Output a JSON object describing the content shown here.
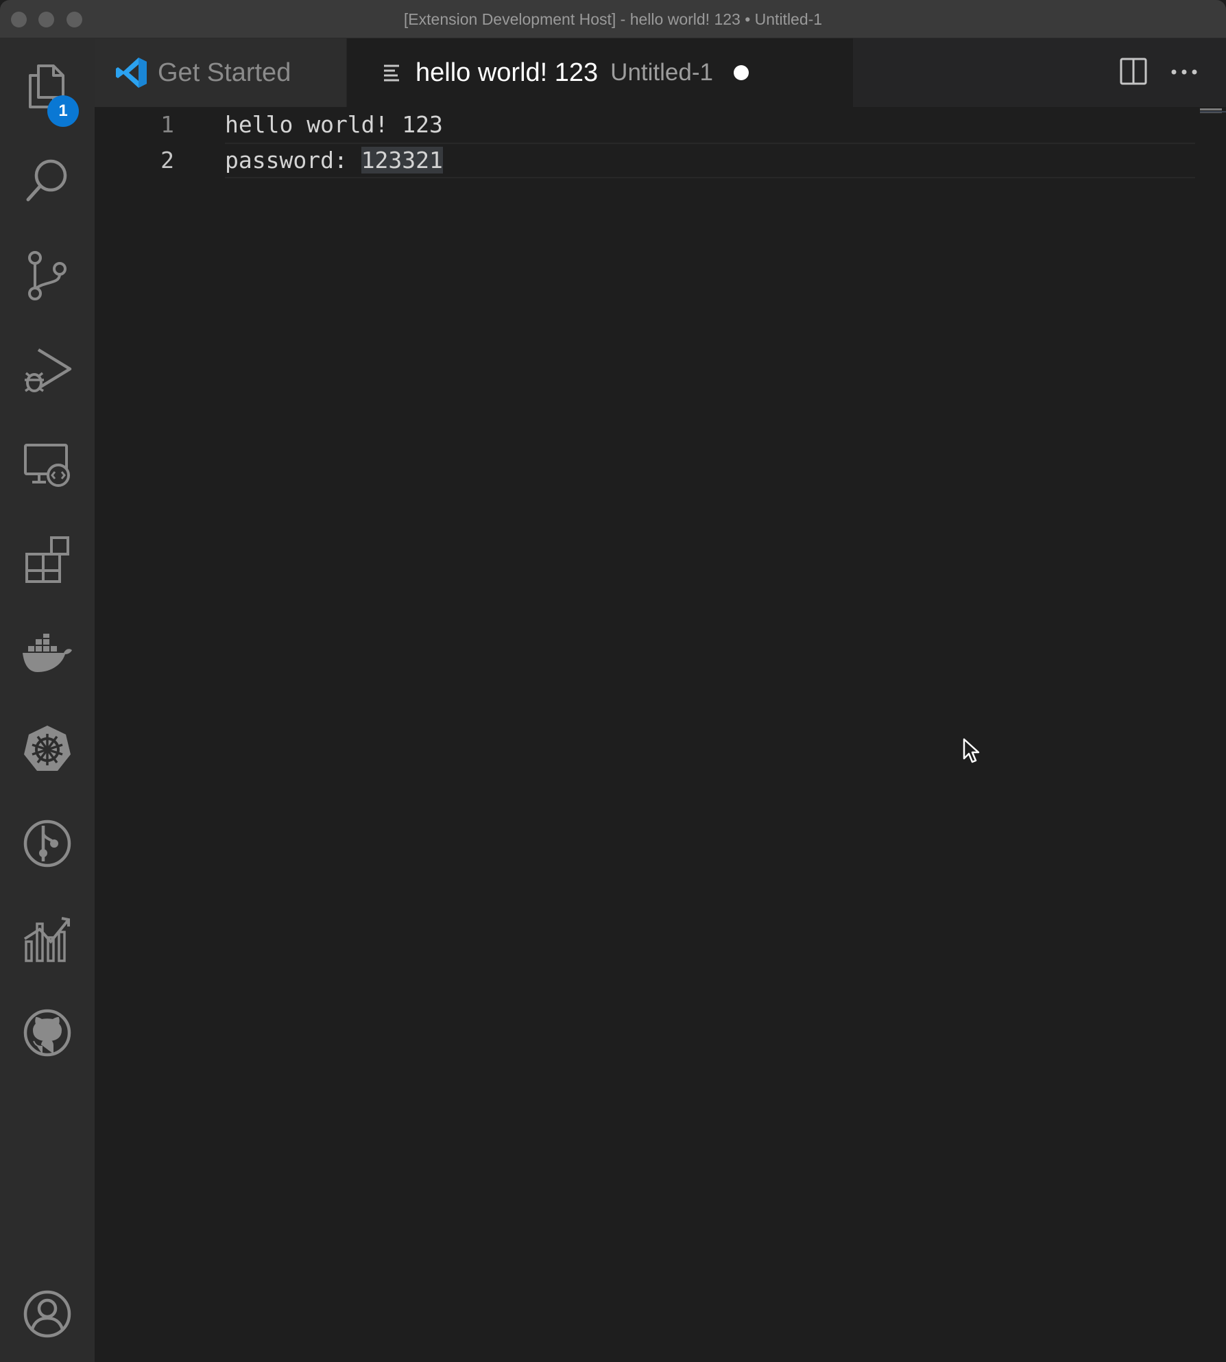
{
  "window": {
    "title": "[Extension Development Host] - hello world! 123 • Untitled-1"
  },
  "activity_bar": {
    "explorer_badge": "1",
    "items": [
      {
        "name": "explorer",
        "icon": "files-icon"
      },
      {
        "name": "search",
        "icon": "search-icon"
      },
      {
        "name": "source-control",
        "icon": "source-control-icon"
      },
      {
        "name": "run-and-debug",
        "icon": "run-debug-icon"
      },
      {
        "name": "remote-explorer",
        "icon": "remote-explorer-icon"
      },
      {
        "name": "extensions",
        "icon": "extensions-icon"
      },
      {
        "name": "docker",
        "icon": "docker-icon"
      },
      {
        "name": "kubernetes",
        "icon": "kubernetes-icon"
      },
      {
        "name": "gitlens",
        "icon": "gitlens-icon"
      },
      {
        "name": "analytics",
        "icon": "chart-icon"
      },
      {
        "name": "github",
        "icon": "github-icon"
      },
      {
        "name": "accounts",
        "icon": "account-icon"
      }
    ]
  },
  "tabs": {
    "inactive": {
      "label": "Get Started",
      "icon": "vscode-logo-icon"
    },
    "active": {
      "label": "hello world! 123",
      "description": "Untitled-1",
      "icon": "text-file-icon",
      "dirty": true
    }
  },
  "tab_actions": {
    "split": "split-editor-icon",
    "more": "more-actions-icon"
  },
  "editor": {
    "lines": [
      {
        "number": "1",
        "text": "hello world! 123"
      },
      {
        "number": "2",
        "prefix": "password: ",
        "highlighted": "123321"
      }
    ]
  },
  "colors": {
    "accent_badge": "#0a78d4",
    "vscode_blue": "#2ba2f0"
  }
}
